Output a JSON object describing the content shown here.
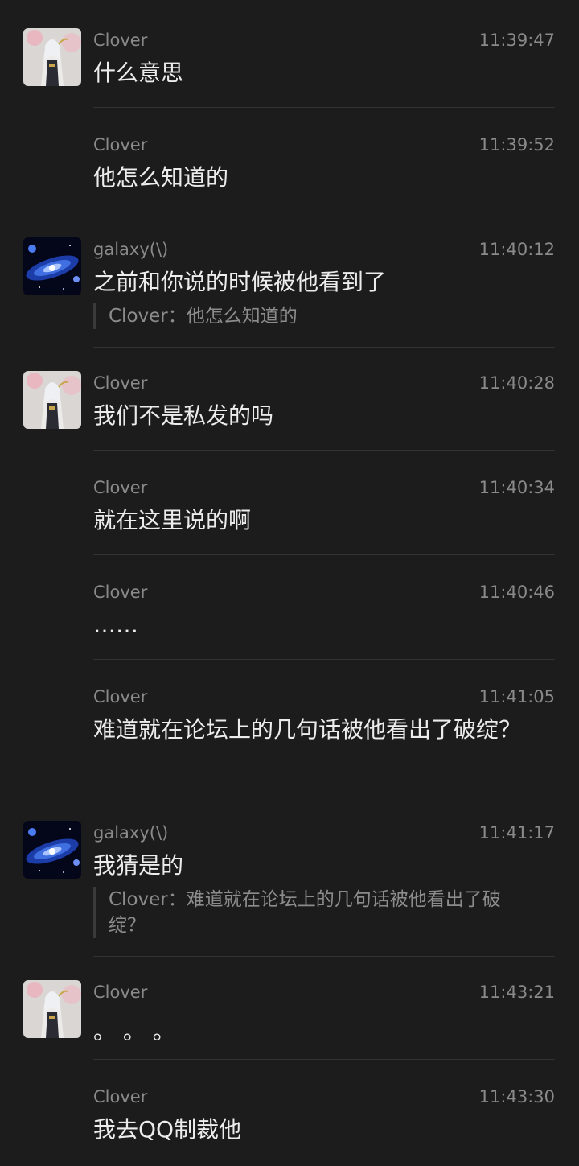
{
  "messages": [
    {
      "name": "Clover",
      "time": "11:39:47",
      "text": "什么意思",
      "avatar": "clover-avatar"
    },
    {
      "name": "Clover",
      "time": "11:39:52",
      "text": "他怎么知道的"
    },
    {
      "name": "galaxy(\\)",
      "time": "11:40:12",
      "text": "之前和你说的时候被他看到了",
      "avatar": "galaxy-avatar",
      "quote": "Clover：他怎么知道的"
    },
    {
      "name": "Clover",
      "time": "11:40:28",
      "text": "我们不是私发的吗",
      "avatar": "clover-avatar"
    },
    {
      "name": "Clover",
      "time": "11:40:34",
      "text": "就在这里说的啊"
    },
    {
      "name": "Clover",
      "time": "11:40:46",
      "text": "……"
    },
    {
      "name": "Clover",
      "time": "11:41:05",
      "text": "难道就在论坛上的几句话被他看出了破绽？"
    },
    {
      "name": "galaxy(\\)",
      "time": "11:41:17",
      "text": "我猜是的",
      "avatar": "galaxy-avatar",
      "quote": "Clover：难道就在论坛上的几句话被他看出了破绽？"
    },
    {
      "name": "Clover",
      "time": "11:43:21",
      "text": "。 。 。",
      "avatar": "clover-avatar"
    },
    {
      "name": "Clover",
      "time": "11:43:30",
      "text": "我去QQ制裁他"
    }
  ],
  "colors": {
    "background": "#1c1c1c",
    "meta": "#8a8a8a",
    "text": "#ececec",
    "divider": "#333333"
  }
}
